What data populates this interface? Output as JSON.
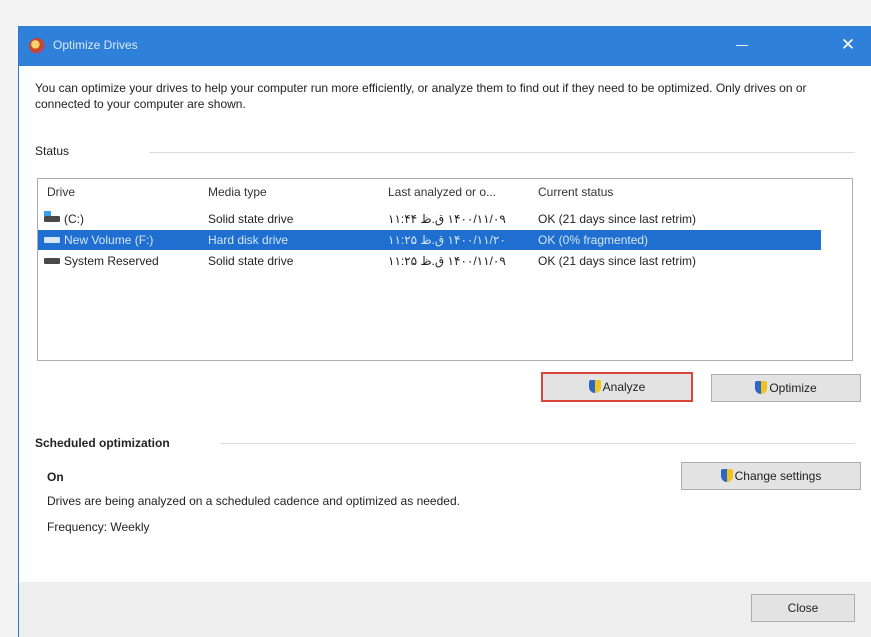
{
  "window": {
    "title": "Optimize Drives",
    "close_glyph": "✕",
    "minimize_icon": "minimize-icon",
    "app_icon": "optimize-drives-icon"
  },
  "intro_text": "You can optimize your drives to help your computer run more efficiently, or analyze them to find out if they need to be optimized. Only drives on or connected to your computer are shown.",
  "status": {
    "label": "Status",
    "columns": [
      "Drive",
      "Media type",
      "Last analyzed or o...",
      "Current status"
    ],
    "drives": [
      {
        "name": "(C:)",
        "media": "Solid state drive",
        "last": "۱۴۰۰/۱۱/۰۹ ق.ظ ۱۱:۴۴",
        "status": "OK (21 days since last retrim)",
        "icon": "os-drive-icon",
        "selected": false
      },
      {
        "name": "New Volume (F:)",
        "media": "Hard disk drive",
        "last": "۱۴۰۰/۱۱/۲۰ ق.ظ ۱۱:۲۵",
        "status": "OK (0% fragmented)",
        "icon": "hdd-icon",
        "selected": true
      },
      {
        "name": "System Reserved",
        "media": "Solid state drive",
        "last": "۱۴۰۰/۱۱/۰۹ ق.ظ ۱۱:۲۵",
        "status": "OK (21 days since last retrim)",
        "icon": "drive-icon",
        "selected": false
      }
    ]
  },
  "buttons": {
    "analyze": "Analyze",
    "optimize": "Optimize",
    "change_settings": "Change settings",
    "close": "Close"
  },
  "scheduled": {
    "label": "Scheduled optimization",
    "state": "On",
    "description": "Drives are being analyzed on a scheduled cadence and optimized as needed.",
    "frequency": "Frequency: Weekly"
  },
  "colors": {
    "titlebar": "#2f80d8",
    "selection": "#1e6fd0",
    "focus_border": "#d9463a"
  }
}
